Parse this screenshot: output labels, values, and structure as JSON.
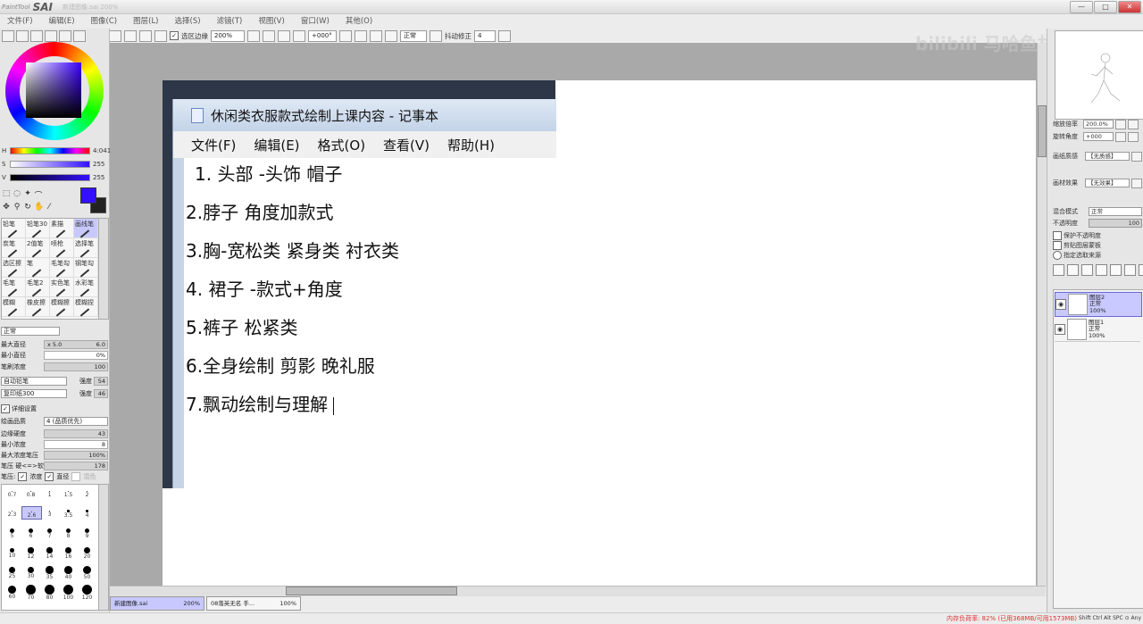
{
  "app": {
    "logo_prefix": "PaintTool",
    "logo_name": "SAI",
    "file_name": "新建图像.sai 200%"
  },
  "window_controls": {
    "minimize": "—",
    "maximize": "□",
    "close": "✕"
  },
  "menu": [
    "文件(F)",
    "编辑(E)",
    "图像(C)",
    "图层(L)",
    "选择(S)",
    "滤镜(T)",
    "视图(V)",
    "窗口(W)",
    "其他(O)"
  ],
  "toolbar": {
    "selection_edge_label": "选区边缘",
    "zoom": "200%",
    "rotation": "+000°",
    "blend": "正常",
    "stabilizer_label": "抖动修正",
    "stabilizer_value": "4"
  },
  "color": {
    "h_label": "H",
    "h_value": "4:041",
    "s_label": "S",
    "s_value": "255",
    "v_label": "V",
    "v_value": "255",
    "foreground": "#3310ff",
    "background": "#222222"
  },
  "tool_icons": [
    "select-rect-icon",
    "lasso-icon",
    "magic-wand-icon",
    "eyedropper-icon",
    "move-icon",
    "zoom-icon",
    "rotate-icon",
    "hand-icon",
    "picker-icon"
  ],
  "brushes": [
    {
      "label": "铅笔",
      "selected": false
    },
    {
      "label": "铅笔30",
      "selected": false
    },
    {
      "label": "素描",
      "selected": false
    },
    {
      "label": "画线笔",
      "selected": true
    },
    {
      "label": "炭笔",
      "selected": false
    },
    {
      "label": "2值笔",
      "selected": false
    },
    {
      "label": "喷枪",
      "selected": false
    },
    {
      "label": "选择笔",
      "selected": false
    },
    {
      "label": "选区擦",
      "selected": false
    },
    {
      "label": "笔",
      "selected": false
    },
    {
      "label": "毛笔勾",
      "selected": false
    },
    {
      "label": "钢笔勾",
      "selected": false
    },
    {
      "label": "毛笔",
      "selected": false
    },
    {
      "label": "毛笔2",
      "selected": false
    },
    {
      "label": "实色笔",
      "selected": false
    },
    {
      "label": "水彩笔",
      "selected": false
    },
    {
      "label": "模糊",
      "selected": false
    },
    {
      "label": "橡皮擦",
      "selected": false
    },
    {
      "label": "模糊擦",
      "selected": false
    },
    {
      "label": "模糊捏",
      "selected": false
    }
  ],
  "brush_params": {
    "blend_mode": "正常",
    "max_size_label": "最大直径",
    "max_size_mult": "x 5.0",
    "max_size_value": "6.0",
    "min_size_label": "最小直径",
    "min_size_value": "0%",
    "density_label": "笔刷浓度",
    "density_value": "100",
    "shape_label": "自动铅笔",
    "shape_strength_label": "强度",
    "shape_strength_value": "54",
    "texture_label": "复印纸300",
    "texture_strength_label": "强度",
    "texture_strength_value": "46",
    "detail_label": "详细设置",
    "quality_label": "绘画品质",
    "quality_value": "4 (品质优先)",
    "edge_hardness_label": "边缘硬度",
    "edge_hardness_value": "43",
    "min_density_label": "最小浓度",
    "min_density_value": "8",
    "max_density_pressure_label": "最大浓度笔压",
    "max_density_pressure_value": "100%",
    "pressure_hardness_label": "笔压 硬<=>软",
    "pressure_hardness_value": "178",
    "pressure_label": "笔压:",
    "pressure_density": "浓度",
    "pressure_size": "直径",
    "pressure_blend": "混色"
  },
  "brush_sizes": [
    "0.7",
    "0.8",
    "1",
    "1.5",
    "2",
    "2.3",
    "2.6",
    "3",
    "3.5",
    "4",
    "5",
    "6",
    "7",
    "8",
    "9",
    "10",
    "12",
    "14",
    "16",
    "20",
    "25",
    "30",
    "35",
    "40",
    "50",
    "60",
    "70",
    "80",
    "100",
    "120"
  ],
  "notepad": {
    "title": "休闲类衣服款式绘制上课内容 - 记事本",
    "menu": [
      "文件(F)",
      "编辑(E)",
      "格式(O)",
      "查看(V)",
      "帮助(H)"
    ],
    "lines": [
      "1. 头部 -头饰  帽子",
      "2.脖子 角度加款式",
      "3.胸-宽松类  紧身类 衬衣类",
      "4. 裙子 -款式+角度",
      "5.裤子 松紧类",
      "6.全身绘制  剪影  晚礼服",
      "7.飘动绘制与理解"
    ]
  },
  "watermark": "bilibili 马哈鱼村",
  "navigator": {
    "zoom_label": "缩放倍率",
    "zoom_value": "200.0%",
    "rotate_label": "旋转角度",
    "rotate_value": "+000"
  },
  "layer_props": {
    "paper_texture_label": "画纸质感",
    "paper_texture_value": "【无质感】",
    "paper_effect_label": "画材效果",
    "paper_effect_value": "【无效果】",
    "blend_label": "混合模式",
    "blend_value": "正常",
    "opacity_label": "不透明度",
    "opacity_value": "100",
    "protect_opacity": "保护不透明度",
    "clip_group": "剪贴图层蒙板",
    "selection_source": "指定选取来源"
  },
  "layers": [
    {
      "name": "图层2",
      "mode": "正常",
      "opacity": "100%",
      "selected": true
    },
    {
      "name": "图层1",
      "mode": "正常",
      "opacity": "100%",
      "selected": false
    }
  ],
  "doc_tabs": [
    {
      "name": "新建图像.sai",
      "zoom": "200%",
      "active": true
    },
    {
      "name": "08落英无名 手...",
      "zoom": "100%",
      "active": false
    }
  ],
  "status": {
    "memory": "内存负荷率: 82% (已用368MB/可用1573MB)",
    "keys": "Shift Ctrl Alt SPC ⊙ Any"
  }
}
